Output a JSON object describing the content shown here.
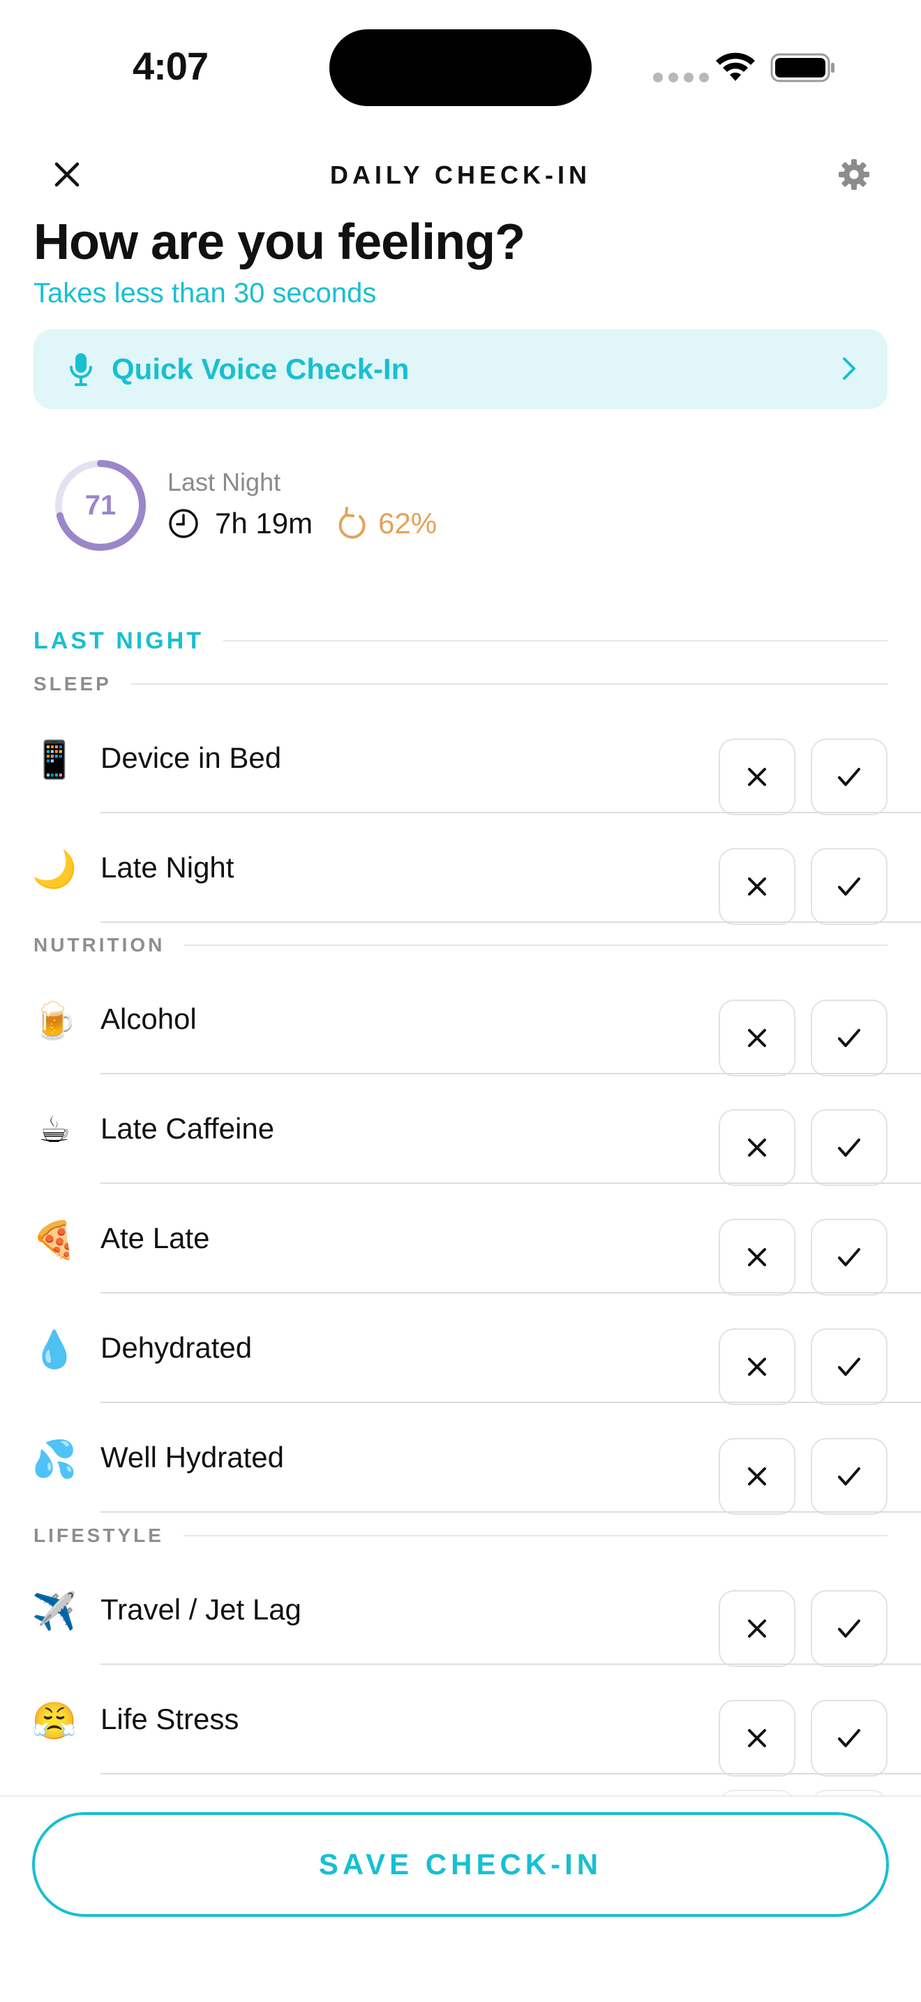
{
  "status_bar": {
    "time": "4:07"
  },
  "header": {
    "title": "DAILY CHECK-IN"
  },
  "intro": {
    "headline": "How are you feeling?",
    "subtitle": "Takes less than 30 seconds"
  },
  "voice_checkin": {
    "label": "Quick Voice Check-In"
  },
  "last_night_summary": {
    "score": "71",
    "score_fraction": 0.71,
    "label": "Last Night",
    "duration": "7h 19m",
    "efficiency": "62%"
  },
  "section_title": "LAST NIGHT",
  "groups": {
    "sleep": {
      "title": "SLEEP",
      "items": [
        {
          "icon": "mobile-phone-icon",
          "emoji": "📱",
          "label": "Device in Bed"
        },
        {
          "icon": "crescent-moon-icon",
          "emoji": "🌙",
          "label": "Late Night"
        }
      ]
    },
    "nutrition": {
      "title": "NUTRITION",
      "items": [
        {
          "icon": "beer-mug-icon",
          "emoji": "🍺",
          "label": "Alcohol"
        },
        {
          "icon": "hot-beverage-icon",
          "emoji": "☕",
          "label": "Late Caffeine"
        },
        {
          "icon": "pizza-icon",
          "emoji": "🍕",
          "label": "Ate Late"
        },
        {
          "icon": "droplet-icon",
          "emoji": "💧",
          "label": "Dehydrated"
        },
        {
          "icon": "sweat-droplets-icon",
          "emoji": "💦",
          "label": "Well Hydrated"
        }
      ]
    },
    "lifestyle": {
      "title": "LIFESTYLE",
      "items": [
        {
          "icon": "airplane-icon",
          "emoji": "✈️",
          "label": "Travel / Jet Lag"
        },
        {
          "icon": "steaming-face-icon",
          "emoji": "😤",
          "label": "Life Stress"
        }
      ]
    }
  },
  "footer": {
    "save_label": "SAVE CHECK-IN"
  },
  "colors": {
    "accent": "#18bfd1",
    "accent_bg": "#e1f6f8",
    "score_ring": "#9b86c9",
    "efficiency": "#e3a25a",
    "muted": "#8e8e8e"
  }
}
